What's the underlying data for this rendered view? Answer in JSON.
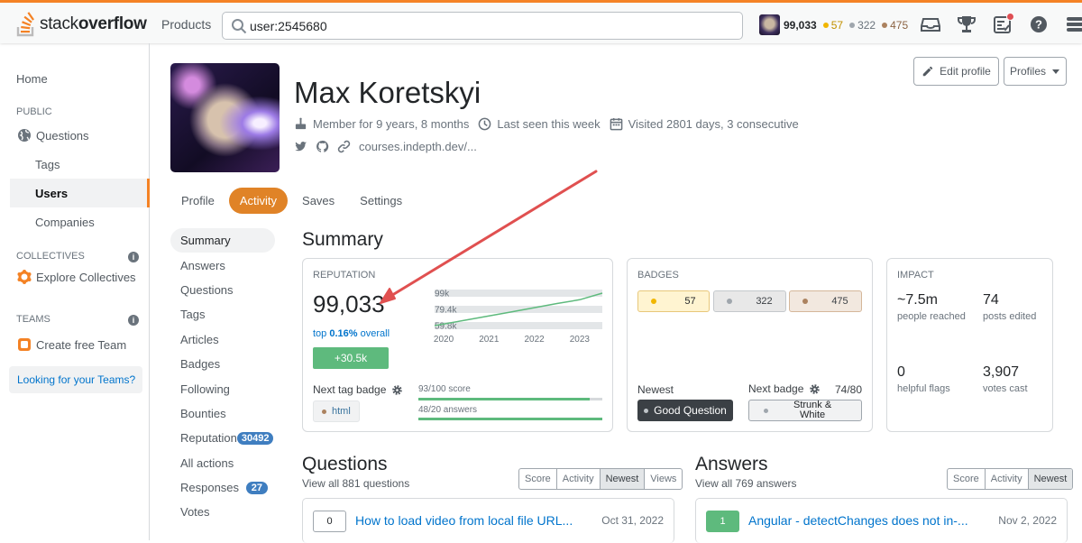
{
  "topbar": {
    "logo_text_light": "stack",
    "logo_text_bold": "overflow",
    "products": "Products",
    "search_value": "user:2545680",
    "reputation": "99,033",
    "gold": "57",
    "silver": "322",
    "bronze": "475"
  },
  "leftnav": {
    "home": "Home",
    "public": "PUBLIC",
    "questions": "Questions",
    "tags": "Tags",
    "users": "Users",
    "companies": "Companies",
    "collectives": "COLLECTIVES",
    "explore_collectives": "Explore Collectives",
    "teams": "TEAMS",
    "create_team": "Create free Team",
    "looking_teams": "Looking for your Teams?"
  },
  "profile": {
    "name": "Max Koretskyi",
    "member_for": "Member for 9 years, 8 months",
    "last_seen": "Last seen this week",
    "visited": "Visited 2801 days, 3 consecutive",
    "website": "courses.indepth.dev/...",
    "edit_profile": "Edit profile",
    "profiles": "Profiles"
  },
  "tabs": [
    "Profile",
    "Activity",
    "Saves",
    "Settings"
  ],
  "subnav": {
    "summary": "Summary",
    "answers": "Answers",
    "questions": "Questions",
    "tags": "Tags",
    "articles": "Articles",
    "badges": "Badges",
    "following": "Following",
    "bounties": "Bounties",
    "reputation": "Reputation",
    "reputation_count": "30492",
    "all_actions": "All actions",
    "responses": "Responses",
    "responses_count": "27",
    "votes": "Votes"
  },
  "summary": {
    "title": "Summary",
    "reputation_label": "REPUTATION",
    "reputation": "99,033",
    "top_prefix": "top ",
    "top_pct": "0.16%",
    "top_suffix": " overall",
    "gain": "+30.5k",
    "next_tag_badge": "Next tag badge",
    "tag": "html",
    "score_progress_label": "93/100 score",
    "score_progress": 0.93,
    "answers_progress_label": "48/20 answers",
    "answers_progress": 1.0,
    "badges_label": "BADGES",
    "gold": "57",
    "silver": "322",
    "bronze": "475",
    "newest_label": "Newest",
    "newest_badge": "Good Question",
    "next_badge_label": "Next badge",
    "next_badge_progress": "74/80",
    "next_badge_line1": "Strunk &",
    "next_badge_line2": "White",
    "impact_label": "IMPACT",
    "people_reached": "~7.5m",
    "people_reached_label": "people reached",
    "posts_edited": "74",
    "posts_edited_label": "posts edited",
    "helpful_flags": "0",
    "helpful_flags_label": "helpful flags",
    "votes_cast": "3,907",
    "votes_cast_label": "votes cast"
  },
  "chart_data": {
    "type": "line",
    "x_ticks": [
      "2020",
      "2021",
      "2022",
      "2023"
    ],
    "y_ticks": [
      "59.8k",
      "79.4k",
      "99k"
    ],
    "ylim": [
      59800,
      99000
    ],
    "x": [
      2019.8,
      2020.5,
      2021.0,
      2021.5,
      2022.0,
      2022.5,
      2023.0,
      2023.5
    ],
    "values": [
      59800,
      66500,
      71500,
      76500,
      81500,
      86500,
      91000,
      99033
    ],
    "color": "#5eba7d"
  },
  "questions": {
    "title": "Questions",
    "view_all": "View all 881 questions",
    "filters": [
      "Score",
      "Activity",
      "Newest",
      "Views"
    ],
    "active_filter": "Newest",
    "first": {
      "score": "0",
      "title": "How to load video from local file URL...",
      "date": "Oct 31, 2022"
    }
  },
  "answers": {
    "title": "Answers",
    "view_all": "View all 769 answers",
    "filters": [
      "Score",
      "Activity",
      "Newest"
    ],
    "active_filter": "Newest",
    "first": {
      "score": "1",
      "title": "Angular - detectChanges does not in-...",
      "date": "Nov 2, 2022"
    }
  },
  "colors": {
    "accent": "#f48225",
    "activity_tab": "#e08327",
    "link": "#0074cc",
    "green": "#5eba7d",
    "annotation_arrow": "#e05050"
  }
}
